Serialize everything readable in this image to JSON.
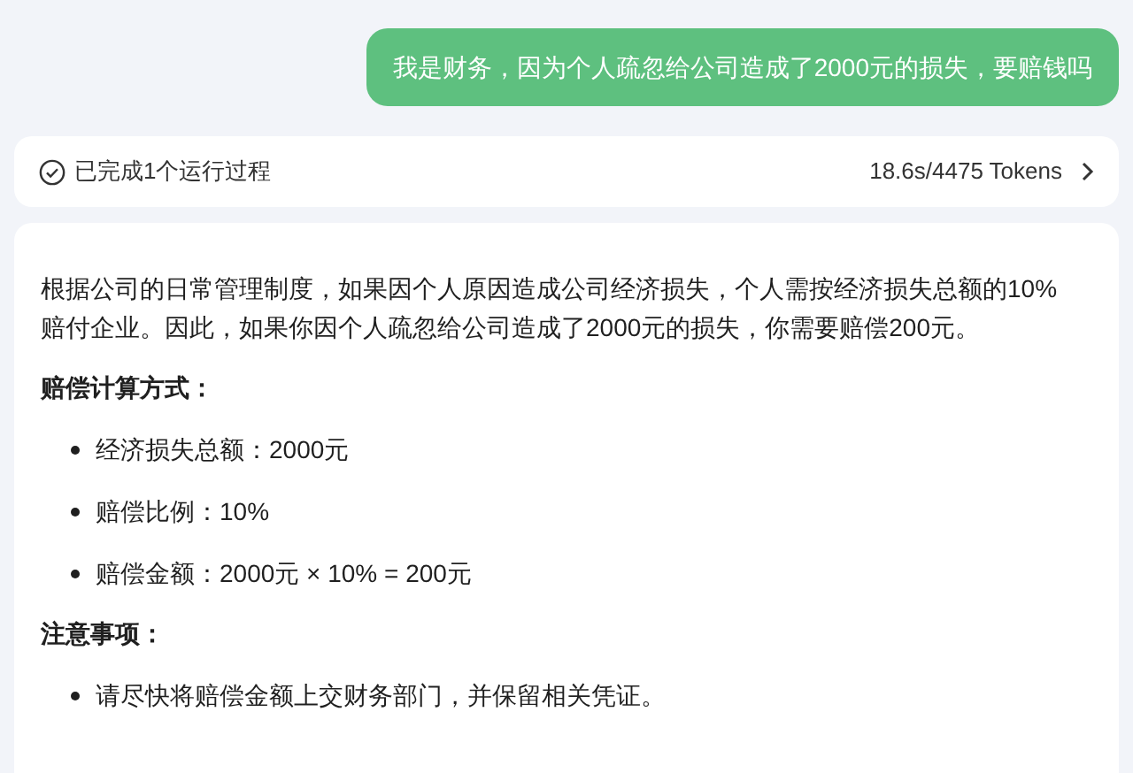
{
  "user_message": "我是财务，因为个人疏忽给公司造成了2000元的损失，要赔钱吗",
  "process_bar": {
    "label": "已完成1个运行过程",
    "stats": "18.6s/4475 Tokens"
  },
  "answer": [
    {
      "kind": "paragraph",
      "text": "根据公司的日常管理制度，如果因个人原因造成公司经济损失，个人需按经济损失总额的10%赔付企业。因此，如果你因个人疏忽给公司造成了2000元的损失，你需要赔偿200元。"
    },
    {
      "kind": "heading",
      "text": "赔偿计算方式："
    },
    {
      "kind": "bullets",
      "items": [
        "经济损失总额：2000元",
        "赔偿比例：10%",
        "赔偿金额：2000元 × 10% = 200元"
      ]
    },
    {
      "kind": "heading",
      "text": "注意事项："
    },
    {
      "kind": "bullets",
      "items": [
        "请尽快将赔偿金额上交财务部门，并保留相关凭证。"
      ]
    }
  ]
}
